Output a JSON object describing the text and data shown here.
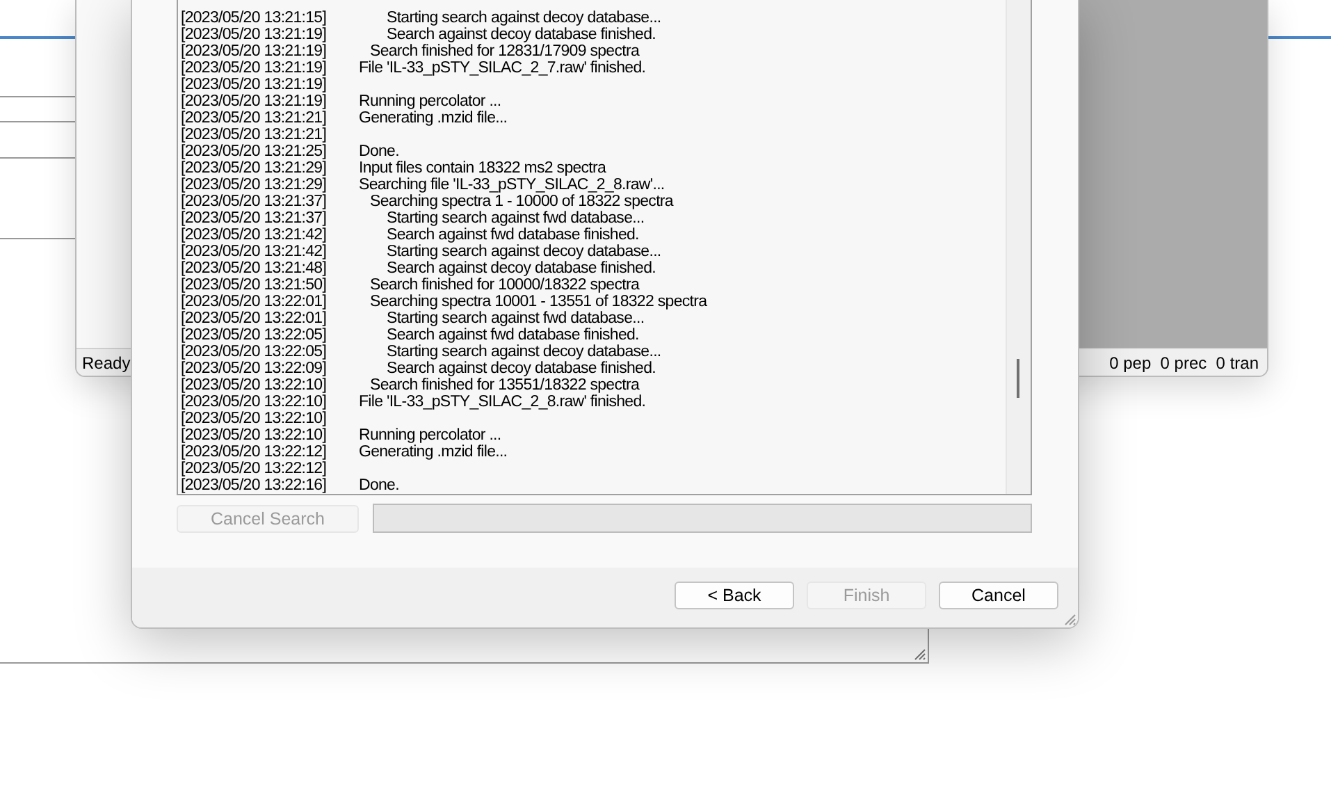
{
  "back_window": {
    "status_left": "Ready",
    "status_right": "0 pep  0 prec  0 tran"
  },
  "dialog": {
    "log": [
      {
        "time": "[2023/05/20 13:21:15]",
        "kind": "subsub",
        "message": "Starting search against decoy database..."
      },
      {
        "time": "[2023/05/20 13:21:19]",
        "kind": "subsub",
        "message": "Search against decoy database finished."
      },
      {
        "time": "[2023/05/20 13:21:19]",
        "kind": "sub",
        "message": "Search finished for 12831/17909 spectra"
      },
      {
        "time": "[2023/05/20 13:21:19]",
        "kind": "top",
        "message": "File 'IL-33_pSTY_SILAC_2_7.raw' finished."
      },
      {
        "time": "[2023/05/20 13:21:19]"
      },
      {
        "time": "[2023/05/20 13:21:19]",
        "kind": "top",
        "message": "Running percolator ..."
      },
      {
        "time": "[2023/05/20 13:21:21]",
        "kind": "top",
        "message": "Generating .mzid file..."
      },
      {
        "time": "[2023/05/20 13:21:21]"
      },
      {
        "time": "[2023/05/20 13:21:25]",
        "kind": "top",
        "message": "Done."
      },
      {
        "time": "[2023/05/20 13:21:29]",
        "kind": "top",
        "message": "Input files contain 18322 ms2 spectra"
      },
      {
        "time": "[2023/05/20 13:21:29]",
        "kind": "top",
        "message": "Searching file 'IL-33_pSTY_SILAC_2_8.raw'..."
      },
      {
        "time": "[2023/05/20 13:21:37]",
        "kind": "sub",
        "message": "Searching spectra 1 - 10000 of 18322 spectra"
      },
      {
        "time": "[2023/05/20 13:21:37]",
        "kind": "subsub",
        "message": "Starting search against fwd database..."
      },
      {
        "time": "[2023/05/20 13:21:42]",
        "kind": "subsub",
        "message": "Search against fwd database finished."
      },
      {
        "time": "[2023/05/20 13:21:42]",
        "kind": "subsub",
        "message": "Starting search against decoy database..."
      },
      {
        "time": "[2023/05/20 13:21:48]",
        "kind": "subsub",
        "message": "Search against decoy database finished."
      },
      {
        "time": "[2023/05/20 13:21:50]",
        "kind": "sub",
        "message": "Search finished for 10000/18322 spectra"
      },
      {
        "time": "[2023/05/20 13:22:01]",
        "kind": "sub",
        "message": "Searching spectra 10001 - 13551 of 18322 spectra"
      },
      {
        "time": "[2023/05/20 13:22:01]",
        "kind": "subsub",
        "message": "Starting search against fwd database..."
      },
      {
        "time": "[2023/05/20 13:22:05]",
        "kind": "subsub",
        "message": "Search against fwd database finished."
      },
      {
        "time": "[2023/05/20 13:22:05]",
        "kind": "subsub",
        "message": "Starting search against decoy database..."
      },
      {
        "time": "[2023/05/20 13:22:09]",
        "kind": "subsub",
        "message": "Search against decoy database finished."
      },
      {
        "time": "[2023/05/20 13:22:10]",
        "kind": "sub",
        "message": "Search finished for 13551/18322 spectra"
      },
      {
        "time": "[2023/05/20 13:22:10]",
        "kind": "top",
        "message": "File 'IL-33_pSTY_SILAC_2_8.raw' finished."
      },
      {
        "time": "[2023/05/20 13:22:10]"
      },
      {
        "time": "[2023/05/20 13:22:10]",
        "kind": "top",
        "message": "Running percolator ..."
      },
      {
        "time": "[2023/05/20 13:22:12]",
        "kind": "top",
        "message": "Generating .mzid file..."
      },
      {
        "time": "[2023/05/20 13:22:12]"
      },
      {
        "time": "[2023/05/20 13:22:16]",
        "kind": "top",
        "message": "Done."
      }
    ],
    "cancel_search": {
      "label": "Cancel Search",
      "disabled": true
    },
    "buttons": [
      {
        "label": "< Back",
        "disabled": false
      },
      {
        "label": "Finish",
        "disabled": true
      },
      {
        "label": "Cancel",
        "disabled": false
      }
    ]
  }
}
